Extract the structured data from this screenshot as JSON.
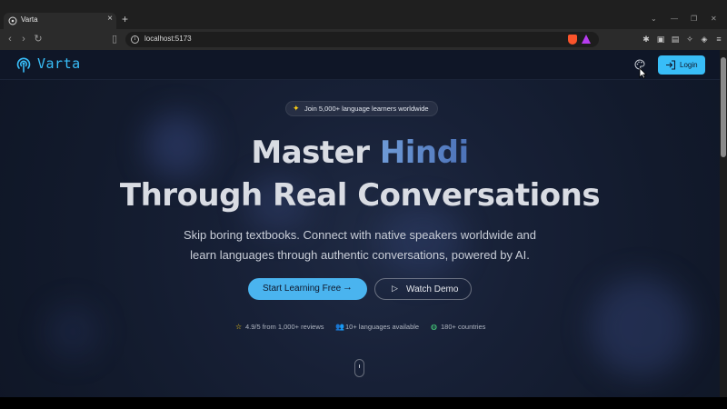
{
  "browser": {
    "tab_title": "Varta",
    "url": "localhost:5173"
  },
  "app": {
    "logo_text": "Varta",
    "login_label": "Login"
  },
  "hero": {
    "badge": "Join 5,000+ language learners worldwide",
    "title_prefix": "Master ",
    "title_highlight": "Hindi",
    "title_line2": "Through Real Conversations",
    "subtitle_line1": "Skip boring textbooks. Connect with native speakers worldwide and",
    "subtitle_line2": "learn languages through authentic conversations, powered by AI.",
    "cta_primary": "Start Learning Free",
    "cta_secondary": "Watch Demo"
  },
  "stats": [
    {
      "icon": "star-icon",
      "text": "4.9/5 from 1,000+ reviews",
      "color": "#facc15"
    },
    {
      "icon": "users-icon",
      "text": "10+ languages available",
      "color": "#60a5fa"
    },
    {
      "icon": "globe-icon",
      "text": "180+ countries",
      "color": "#4ade80"
    }
  ],
  "colors": {
    "accent": "#38bdf8",
    "highlight": "#5a84c6",
    "background": "#141c30"
  }
}
